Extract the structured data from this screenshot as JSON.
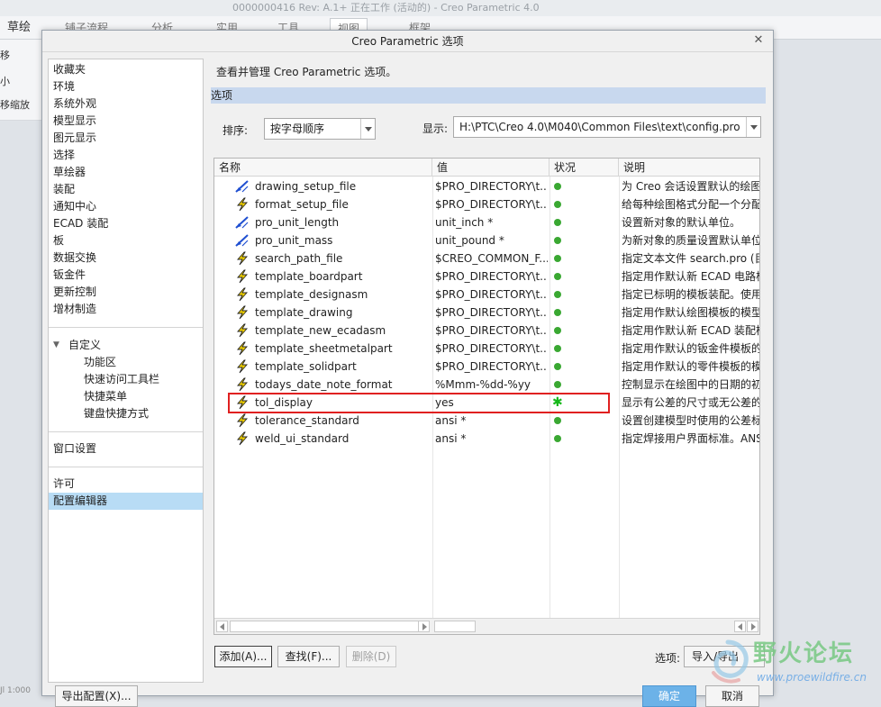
{
  "background": {
    "title_fragment": "0000000416 Rev: A.1+ 正在工作 (活动的) - Creo Parametric 4.0",
    "ribbon_tabs": [
      "草绘",
      "铺子流程",
      "分析",
      "实用",
      "工具",
      "视图",
      "框架"
    ],
    "active_tab_index": 5,
    "left_labels": [
      "移",
      "小",
      "移缩放"
    ],
    "status_fragment": "Jl 1:000",
    "bottom_button": "导出配置(X)..."
  },
  "dialog": {
    "title": "Creo Parametric 选项",
    "description": "查看并管理 Creo Parametric 选项。",
    "section_header": "选项",
    "nav_items": [
      "收藏夹",
      "环境",
      "系统外观",
      "模型显示",
      "图元显示",
      "选择",
      "草绘器",
      "装配",
      "通知中心",
      "ECAD 装配",
      "板",
      "数据交换",
      "钣金件",
      "更新控制",
      "增材制造"
    ],
    "customize_group": "自定义",
    "customize_items": [
      "功能区",
      "快速访问工具栏",
      "快捷菜单",
      "键盘快捷方式"
    ],
    "window_settings": "窗口设置",
    "license": "许可",
    "config_editor": "配置编辑器",
    "sort_label": "排序:",
    "sort_value": "按字母顺序",
    "show_label": "显示:",
    "show_value": "H:\\PTC\\Creo 4.0\\M040\\Common Files\\text\\config.pro",
    "columns": [
      "名称",
      "值",
      "状况",
      "说明"
    ],
    "rows": [
      {
        "icon": "pen",
        "name": "drawing_setup_file",
        "value": "$PRO_DIRECTORY\\t...",
        "status": "dot",
        "desc": "为 Creo 会话设置默认的绘图"
      },
      {
        "icon": "bolt",
        "name": "format_setup_file",
        "value": "$PRO_DIRECTORY\\t...",
        "status": "dot",
        "desc": "给每种绘图格式分配一个分配"
      },
      {
        "icon": "pen",
        "name": "pro_unit_length",
        "value": "unit_inch *",
        "status": "dot",
        "desc": "设置新对象的默认单位。"
      },
      {
        "icon": "pen",
        "name": "pro_unit_mass",
        "value": "unit_pound *",
        "status": "dot",
        "desc": "为新对象的质量设置默认单位"
      },
      {
        "icon": "bolt",
        "name": "search_path_file",
        "value": "$CREO_COMMON_F...",
        "status": "dot",
        "desc": "指定文本文件 search.pro (目"
      },
      {
        "icon": "bolt",
        "name": "template_boardpart",
        "value": "$PRO_DIRECTORY\\t...",
        "status": "dot",
        "desc": "指定用作默认新 ECAD 电路板"
      },
      {
        "icon": "bolt",
        "name": "template_designasm",
        "value": "$PRO_DIRECTORY\\t...",
        "status": "dot",
        "desc": "指定已标明的模板装配。使用"
      },
      {
        "icon": "bolt",
        "name": "template_drawing",
        "value": "$PRO_DIRECTORY\\t...",
        "status": "dot",
        "desc": "指定用作默认绘图模板的模型"
      },
      {
        "icon": "bolt",
        "name": "template_new_ecadasm",
        "value": "$PRO_DIRECTORY\\t...",
        "status": "dot",
        "desc": "指定用作默认新 ECAD 装配模"
      },
      {
        "icon": "bolt",
        "name": "template_sheetmetalpart",
        "value": "$PRO_DIRECTORY\\t...",
        "status": "dot",
        "desc": "指定用作默认的钣金件模板的"
      },
      {
        "icon": "bolt",
        "name": "template_solidpart",
        "value": "$PRO_DIRECTORY\\t...",
        "status": "dot",
        "desc": "指定用作默认的零件模板的模"
      },
      {
        "icon": "bolt",
        "name": "todays_date_note_format",
        "value": "%Mmm-%dd-%yy",
        "status": "dot",
        "desc": "控制显示在绘图中的日期的初"
      },
      {
        "icon": "bolt",
        "name": "tol_display",
        "value": "yes",
        "status": "star",
        "desc": "显示有公差的尺寸或无公差的"
      },
      {
        "icon": "bolt",
        "name": "tolerance_standard",
        "value": "ansi *",
        "status": "dot",
        "desc": "设置创建模型时使用的公差标"
      },
      {
        "icon": "bolt",
        "name": "weld_ui_standard",
        "value": "ansi *",
        "status": "dot",
        "desc": "指定焊接用户界面标准。ANS"
      }
    ],
    "buttons": {
      "add": "添加(A)...",
      "find": "查找(F)...",
      "delete": "删除(D)"
    },
    "options_label": "选项:",
    "import_export": "导入/导出",
    "ok": "确定",
    "cancel": "取消"
  },
  "colors": {
    "accent": "#b8dcf5",
    "status_green": "#3aa832",
    "highlight": "#e02020"
  },
  "watermark": {
    "text": "野火论坛",
    "url": "www.proewildfire.cn"
  }
}
